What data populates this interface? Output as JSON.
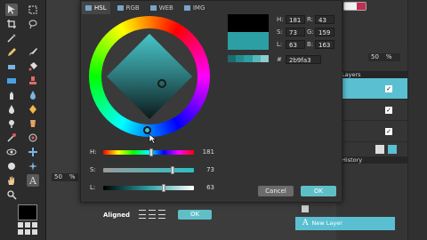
{
  "picker": {
    "tabs": [
      {
        "label": "HSL",
        "icon": "hsl-icon"
      },
      {
        "label": "RGB",
        "icon": "rgb-icon"
      },
      {
        "label": "WEB",
        "icon": "web-icon"
      },
      {
        "label": "IMG",
        "icon": "img-icon"
      }
    ],
    "sliders": {
      "h": {
        "label": "H:",
        "value": "181",
        "level": 0.5
      },
      "s": {
        "label": "S:",
        "value": "73",
        "level": 0.73
      },
      "l": {
        "label": "L:",
        "value": "63",
        "level": 0.63
      }
    },
    "fields": {
      "h_label": "H:",
      "h_value": "181",
      "s_label": "S:",
      "s_value": "73",
      "l_label": "L:",
      "l_value": "63",
      "r_label": "R:",
      "r_value": "43",
      "g_label": "G:",
      "g_value": "159",
      "b_label": "B:",
      "b_value": "163",
      "hex_label": "#",
      "hex_value": "2b9fa3"
    },
    "old_color": "#000000",
    "new_color": "#2b9fa3",
    "swatches": [
      "#1d6b6e",
      "#258a8d",
      "#2b9fa3",
      "#59b6b9",
      "#8ccdcf"
    ],
    "cancel_label": "Cancel",
    "ok_label": "OK"
  },
  "zoom": {
    "left_value": "50",
    "left_unit": "%",
    "right_value": "50",
    "right_unit": "%"
  },
  "layers": {
    "title": "Layers",
    "accent": "#5bbfd2"
  },
  "history": {
    "title": "History",
    "selected_item": "New Layer"
  },
  "options_bar": {
    "aligned_label": "Aligned",
    "ok_label": "OK"
  },
  "colors": {
    "accent": "#5fbfc7",
    "panel": "#2c2c2c",
    "dialog": "#333333"
  }
}
